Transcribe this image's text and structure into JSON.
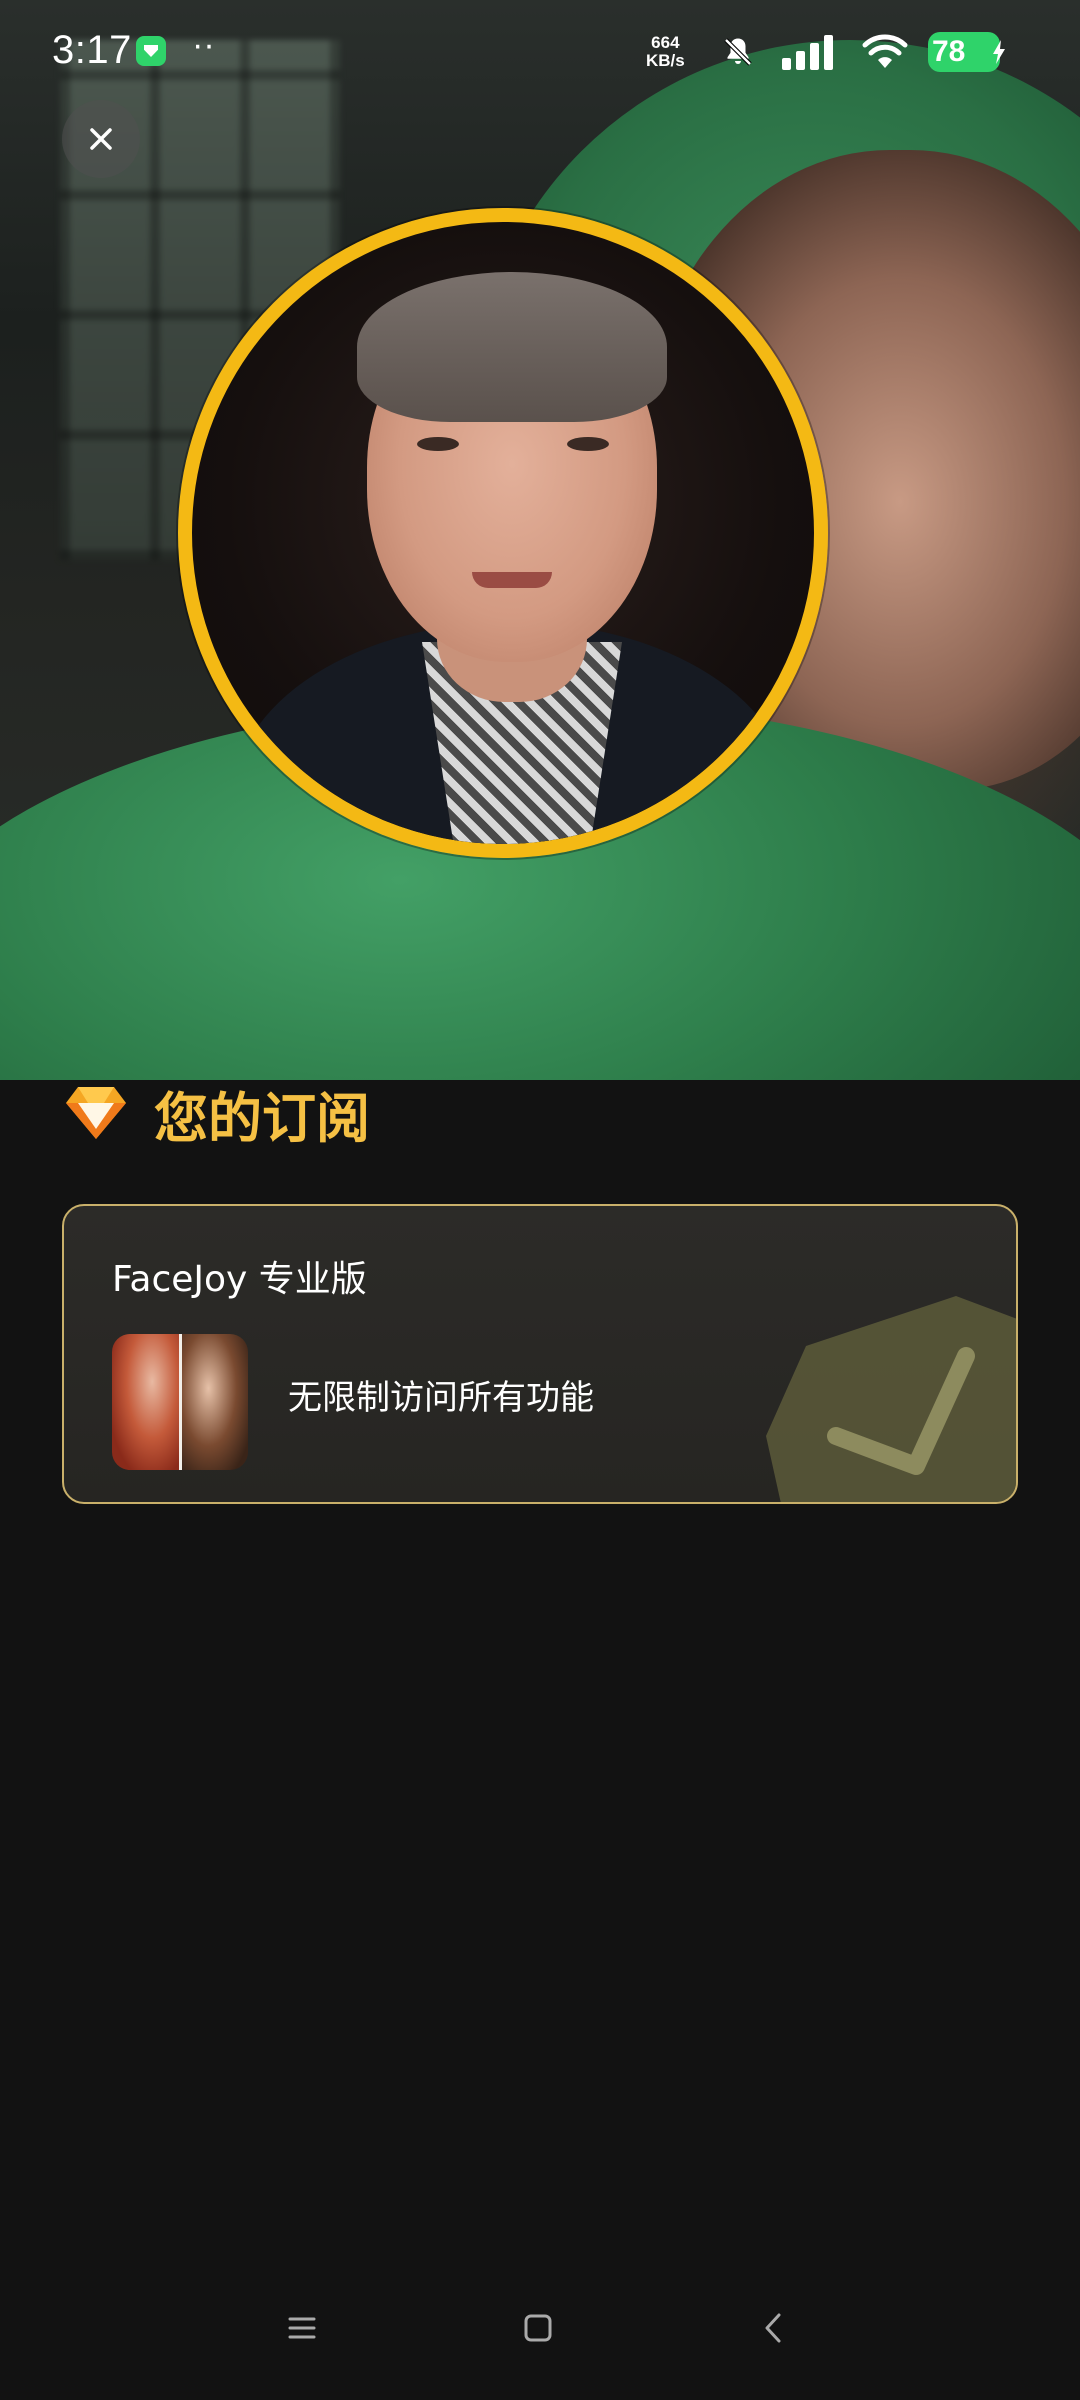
{
  "status_bar": {
    "time": "3:17",
    "dots": "··",
    "net_speed_value": "664",
    "net_speed_unit": "KB/s",
    "battery": "78"
  },
  "subscription": {
    "title": "您的订阅",
    "plan": {
      "name": "FaceJoy 专业版",
      "description": "无限制访问所有功能"
    }
  },
  "colors": {
    "accent_gold": "#f5c044",
    "ring_yellow": "#f4b914",
    "battery_green": "#2fd36a"
  },
  "icons": {
    "close": "close-icon",
    "diamond": "diamond-icon",
    "check": "check-icon",
    "nav_menu": "menu-icon",
    "nav_home": "home-icon",
    "nav_back": "back-icon"
  }
}
